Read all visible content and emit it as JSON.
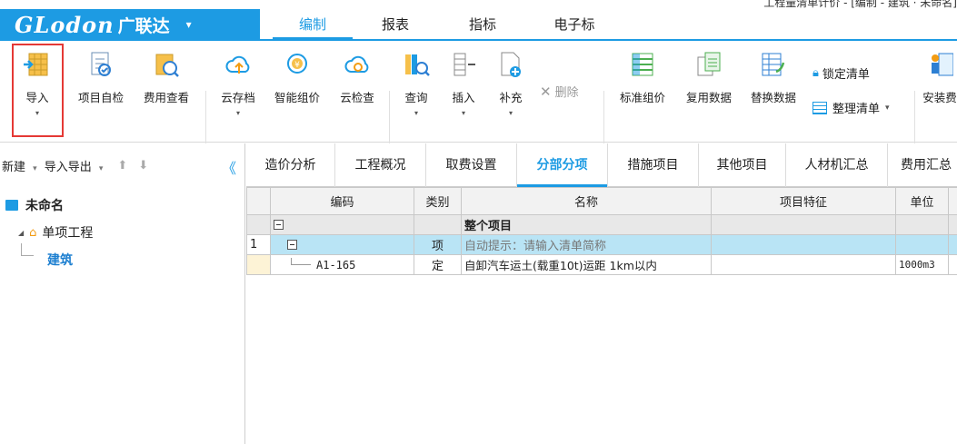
{
  "title_bar": {
    "text": "工程量清单计价 - [编制 - 建筑 · 未命名]"
  },
  "app": {
    "brand": "GLodon",
    "brand_cn": "广联达",
    "menu_arrow": "▾"
  },
  "menu": {
    "tabs": [
      {
        "label": "编制",
        "active": true
      },
      {
        "label": "报表",
        "active": false
      },
      {
        "label": "指标",
        "active": false
      },
      {
        "label": "电子标",
        "active": false
      }
    ]
  },
  "ribbon": {
    "import": "导入",
    "self_check": "项目自检",
    "cost_view": "费用查看",
    "cloud_save": "云存档",
    "smart_price": "智能组价",
    "cloud_check": "云检查",
    "query": "查询",
    "insert": "插入",
    "supplement": "补充",
    "delete": "删除",
    "std_price": "标准组价",
    "reuse_data": "复用数据",
    "replace_data": "替换数据",
    "lock_list": "锁定清单",
    "arrange_list": "整理清单",
    "install_fee": "安装费",
    "dropdown": "▾"
  },
  "left_panel": {
    "new": "新建",
    "import_export": "导入导出",
    "arrow_dd": "▾",
    "up": "⬆",
    "down": "⬇",
    "collapse": "《",
    "root": "未命名",
    "node": "单项工程",
    "leaf": "建筑"
  },
  "content_tabs": [
    {
      "label": "造价分析",
      "active": false
    },
    {
      "label": "工程概况",
      "active": false
    },
    {
      "label": "取费设置",
      "active": false
    },
    {
      "label": "分部分项",
      "active": true
    },
    {
      "label": "措施项目",
      "active": false
    },
    {
      "label": "其他项目",
      "active": false
    },
    {
      "label": "人材机汇总",
      "active": false
    },
    {
      "label": "费用汇总",
      "active": false
    }
  ],
  "grid": {
    "columns": [
      "",
      "编码",
      "类别",
      "名称",
      "项目特征",
      "单位"
    ],
    "rows": [
      {
        "no": "",
        "code": "",
        "type": "",
        "name": "整个项目",
        "feature": "",
        "unit": ""
      },
      {
        "no": "1",
        "code": "",
        "type": "项",
        "name": "自动提示：请输入清单简称",
        "feature": "",
        "unit": ""
      },
      {
        "no": "",
        "code": "A1-165",
        "type": "定",
        "name": "自卸汽车运土(载重10t)运距 1km以内",
        "feature": "",
        "unit": "1000m3"
      }
    ]
  },
  "colors": {
    "accent": "#1d9be3",
    "highlight": "#e53935",
    "selected_row": "#b9e4f5"
  }
}
